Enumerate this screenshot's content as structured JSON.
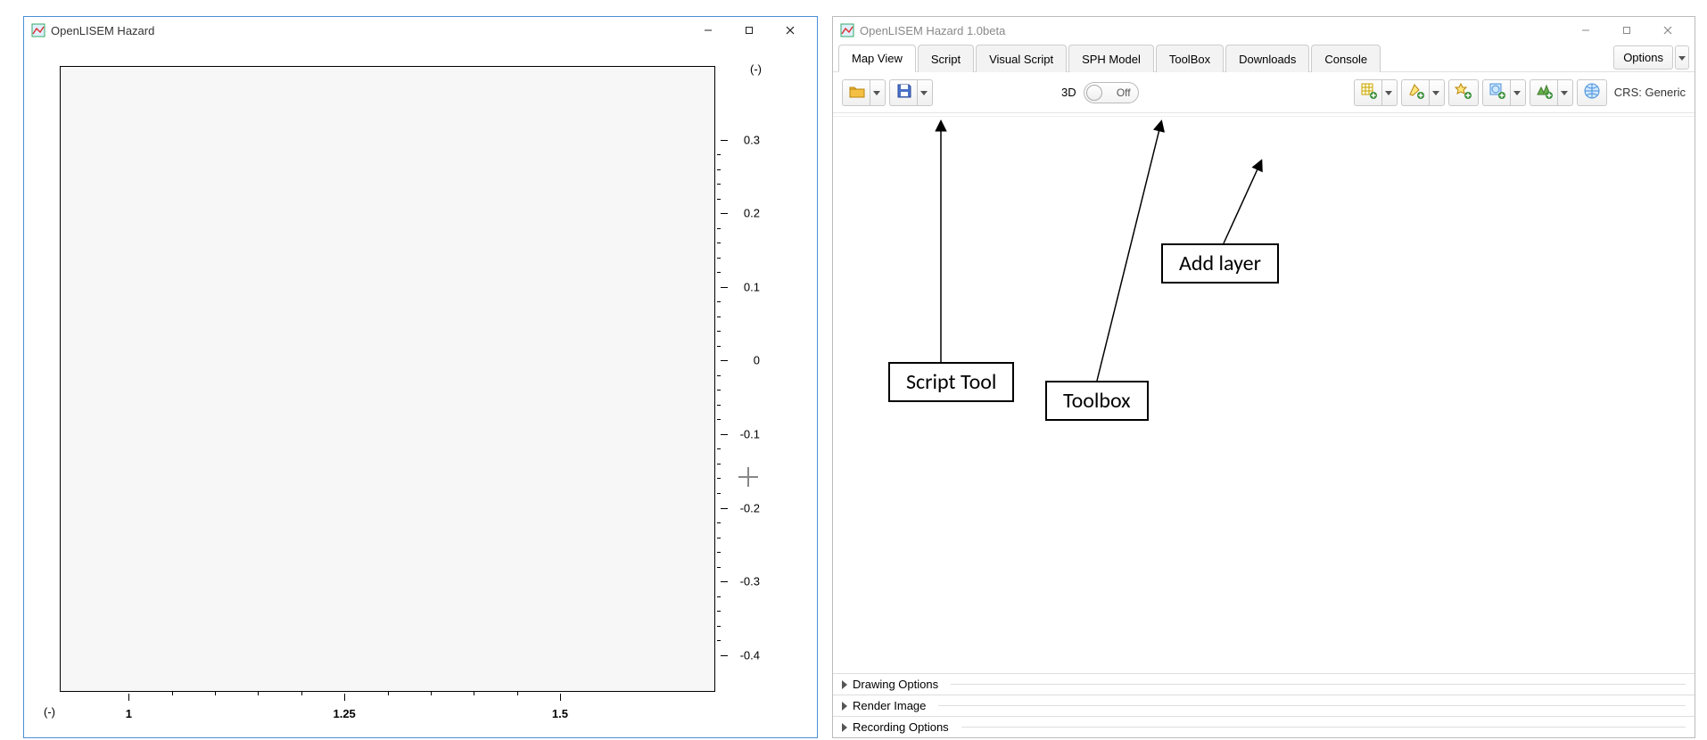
{
  "left_window": {
    "title": "OpenLISEM Hazard",
    "y_unit": "(-)",
    "x_unit": "(-)",
    "y_ticks": [
      "0.3",
      "0.2",
      "0.1",
      "0",
      "-0.1",
      "-0.2",
      "-0.3",
      "-0.4"
    ],
    "x_ticks": [
      "1",
      "1.25",
      "1.5"
    ]
  },
  "right_window": {
    "title": "OpenLISEM Hazard 1.0beta",
    "tabs": [
      {
        "label": "Map View",
        "active": true
      },
      {
        "label": "Script",
        "active": false
      },
      {
        "label": "Visual Script",
        "active": false
      },
      {
        "label": "SPH Model",
        "active": false
      },
      {
        "label": "ToolBox",
        "active": false
      },
      {
        "label": "Downloads",
        "active": false
      },
      {
        "label": "Console",
        "active": false
      }
    ],
    "options_label": "Options",
    "toolbar": {
      "threeD_label": "3D",
      "threeD_state": "Off",
      "crs_label": "CRS: Generic"
    },
    "panels": [
      "Drawing Options",
      "Render Image",
      "Recording Options"
    ]
  },
  "annotations": {
    "script_tool": "Script Tool",
    "toolbox": "Toolbox",
    "add_layer": "Add layer"
  }
}
